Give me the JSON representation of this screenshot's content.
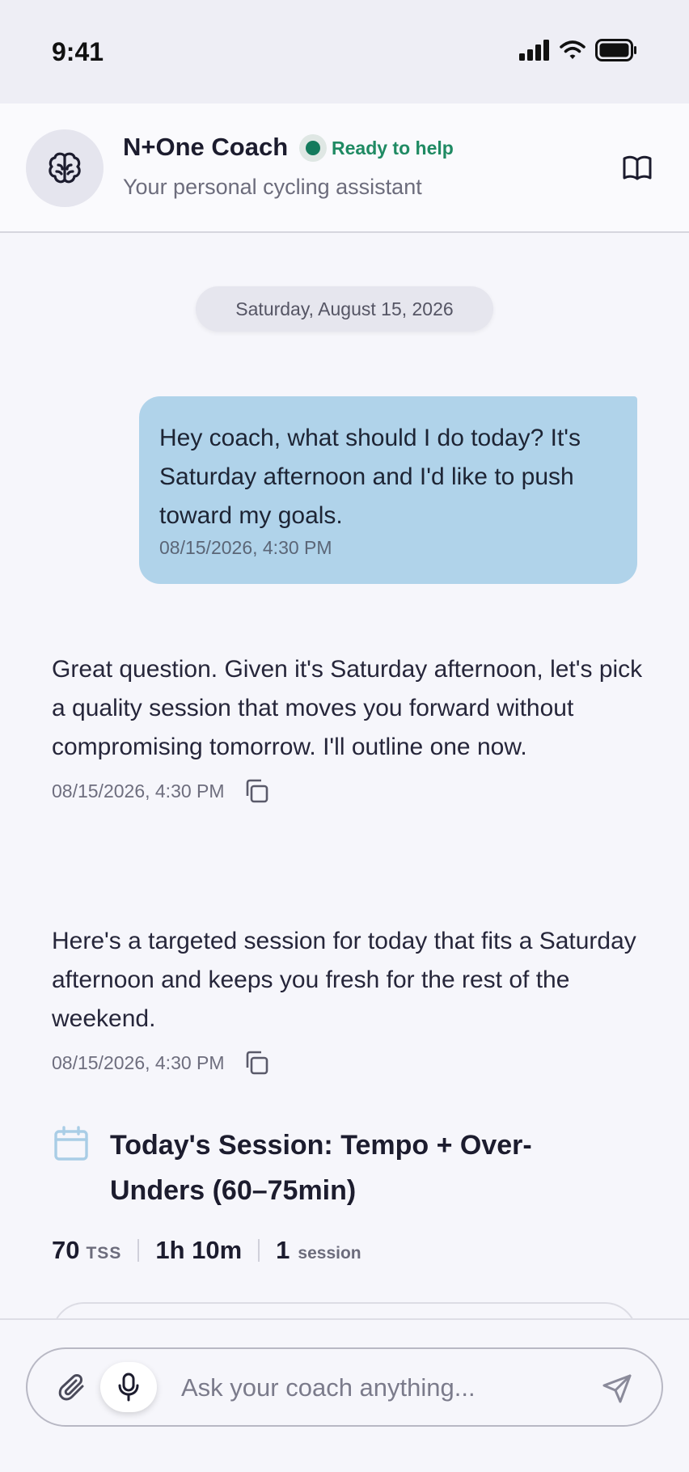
{
  "status_bar": {
    "time": "9:41",
    "icons": [
      "signal-icon",
      "wifi-icon",
      "battery-icon"
    ]
  },
  "header": {
    "title": "N+One Coach",
    "status": "Ready to help",
    "subtitle": "Your personal cycling assistant",
    "avatar_icon": "brain-icon",
    "action_icon": "book-icon",
    "status_color": "#137a5c"
  },
  "conversation": {
    "date_divider": "Saturday, August 15, 2026",
    "user_message": {
      "text": "Hey coach, what should I do today? It's Saturday afternoon and I'd like to push toward my goals.",
      "time": "08/15/2026, 4:30 PM",
      "bubble_color": "#b0d3ea"
    },
    "ai_messages": [
      {
        "text": "Great question. Given it's Saturday afternoon, let's pick a quality session that moves you forward without compromising tomorrow. I'll outline one now.",
        "time": "08/15/2026, 4:30 PM"
      },
      {
        "text": "Here's a targeted session for today that fits a Saturday afternoon and keeps you fresh for the rest of the weekend.",
        "time": "08/15/2026, 4:30 PM"
      }
    ],
    "session": {
      "icon": "calendar-icon",
      "title": "Today's Session: Tempo + Over-Unders (60–75min)",
      "stats": [
        {
          "value": "70",
          "unit": "TSS"
        },
        {
          "value": "1h 10m",
          "unit": ""
        },
        {
          "value": "1",
          "unit": "session"
        }
      ]
    }
  },
  "composer": {
    "placeholder": "Ask your coach anything...",
    "attach_icon": "paperclip-icon",
    "mic_icon": "microphone-icon",
    "send_icon": "send-icon"
  }
}
